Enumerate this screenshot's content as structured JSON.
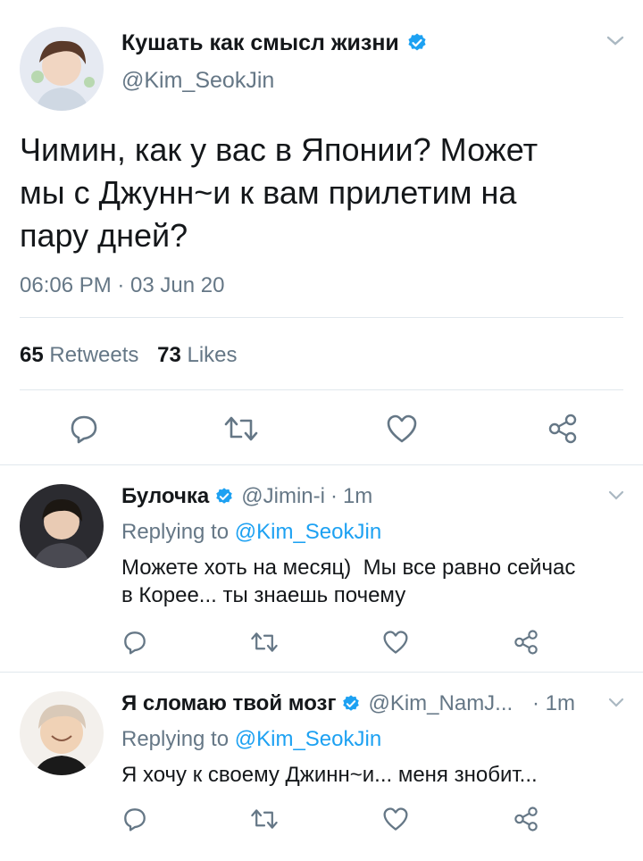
{
  "main_tweet": {
    "display_name": "Кушать как смысл жизни",
    "handle": "@Kim_SeokJin",
    "text_lines": [
      "Чимин, как у вас в Японии? Может",
      "мы с Джунн~и к вам прилетим на",
      "пару дней?"
    ],
    "time": "06:06 PM · 03 Jun 20",
    "retweets_count": "65",
    "retweets_label": "Retweets",
    "likes_count": "73",
    "likes_label": "Likes"
  },
  "replies": [
    {
      "display_name": "Булочка",
      "handle": "@Jimin-i",
      "sep": "·",
      "time": "1m",
      "replying_label": "Replying to",
      "replying_handle": "@Kim_SeokJin",
      "text_lines": [
        "Можете хоть на месяц)  Мы все равно сейчас",
        "в Корее... ты знаешь почему"
      ]
    },
    {
      "display_name": "Я сломаю твой мозг",
      "handle": "@Kim_NamJ...",
      "sep": "·",
      "time": "1m",
      "replying_label": "Replying to",
      "replying_handle": "@Kim_SeokJin",
      "text_lines": [
        "Я хочу к своему Джинн~и... меня знобит..."
      ]
    }
  ],
  "colors": {
    "accent": "#1da1f2",
    "muted": "#657786",
    "divider": "#e1e8ed",
    "text": "#14171a"
  },
  "icons": [
    "reply-icon",
    "retweet-icon",
    "like-icon",
    "share-icon",
    "verified-icon",
    "chevron-down-icon"
  ]
}
